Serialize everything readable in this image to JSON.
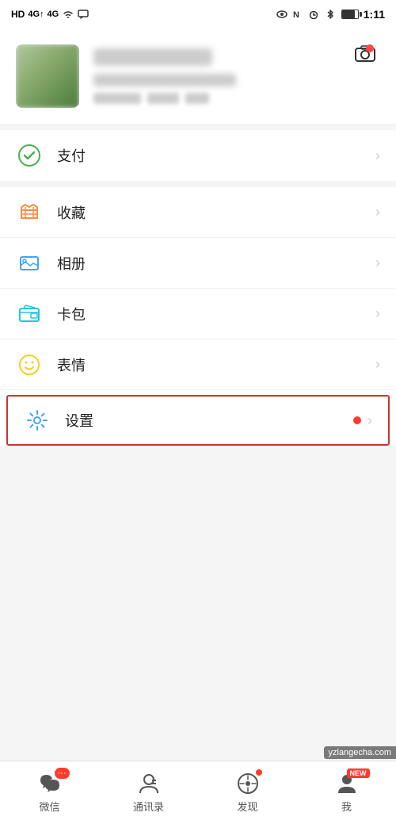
{
  "statusBar": {
    "network": "HD 4G 4G",
    "time": "1:11",
    "batteryLevel": 80
  },
  "profile": {
    "cameraLabel": "相机"
  },
  "menu": {
    "items": [
      {
        "id": "payment",
        "label": "支付",
        "icon": "payment-icon",
        "dot": false,
        "highlight": false
      },
      {
        "id": "favorites",
        "label": "收藏",
        "icon": "favorites-icon",
        "dot": false,
        "highlight": false
      },
      {
        "id": "album",
        "label": "相册",
        "icon": "album-icon",
        "dot": false,
        "highlight": false
      },
      {
        "id": "wallet",
        "label": "卡包",
        "icon": "wallet-icon",
        "dot": false,
        "highlight": false
      },
      {
        "id": "emoji",
        "label": "表情",
        "icon": "emoji-icon",
        "dot": false,
        "highlight": false
      },
      {
        "id": "settings",
        "label": "设置",
        "icon": "settings-icon",
        "dot": true,
        "highlight": true
      }
    ]
  },
  "bottomNav": {
    "items": [
      {
        "id": "wechat",
        "label": "微信",
        "badge": "···",
        "hasBadge": true
      },
      {
        "id": "contacts",
        "label": "通讯录",
        "badge": "",
        "hasBadge": false
      },
      {
        "id": "discover",
        "label": "发现",
        "badge": "",
        "hasDot": true
      },
      {
        "id": "me",
        "label": "我",
        "badge": "NEW",
        "hasNew": true
      }
    ]
  },
  "watermark": "yzlangecha.com"
}
